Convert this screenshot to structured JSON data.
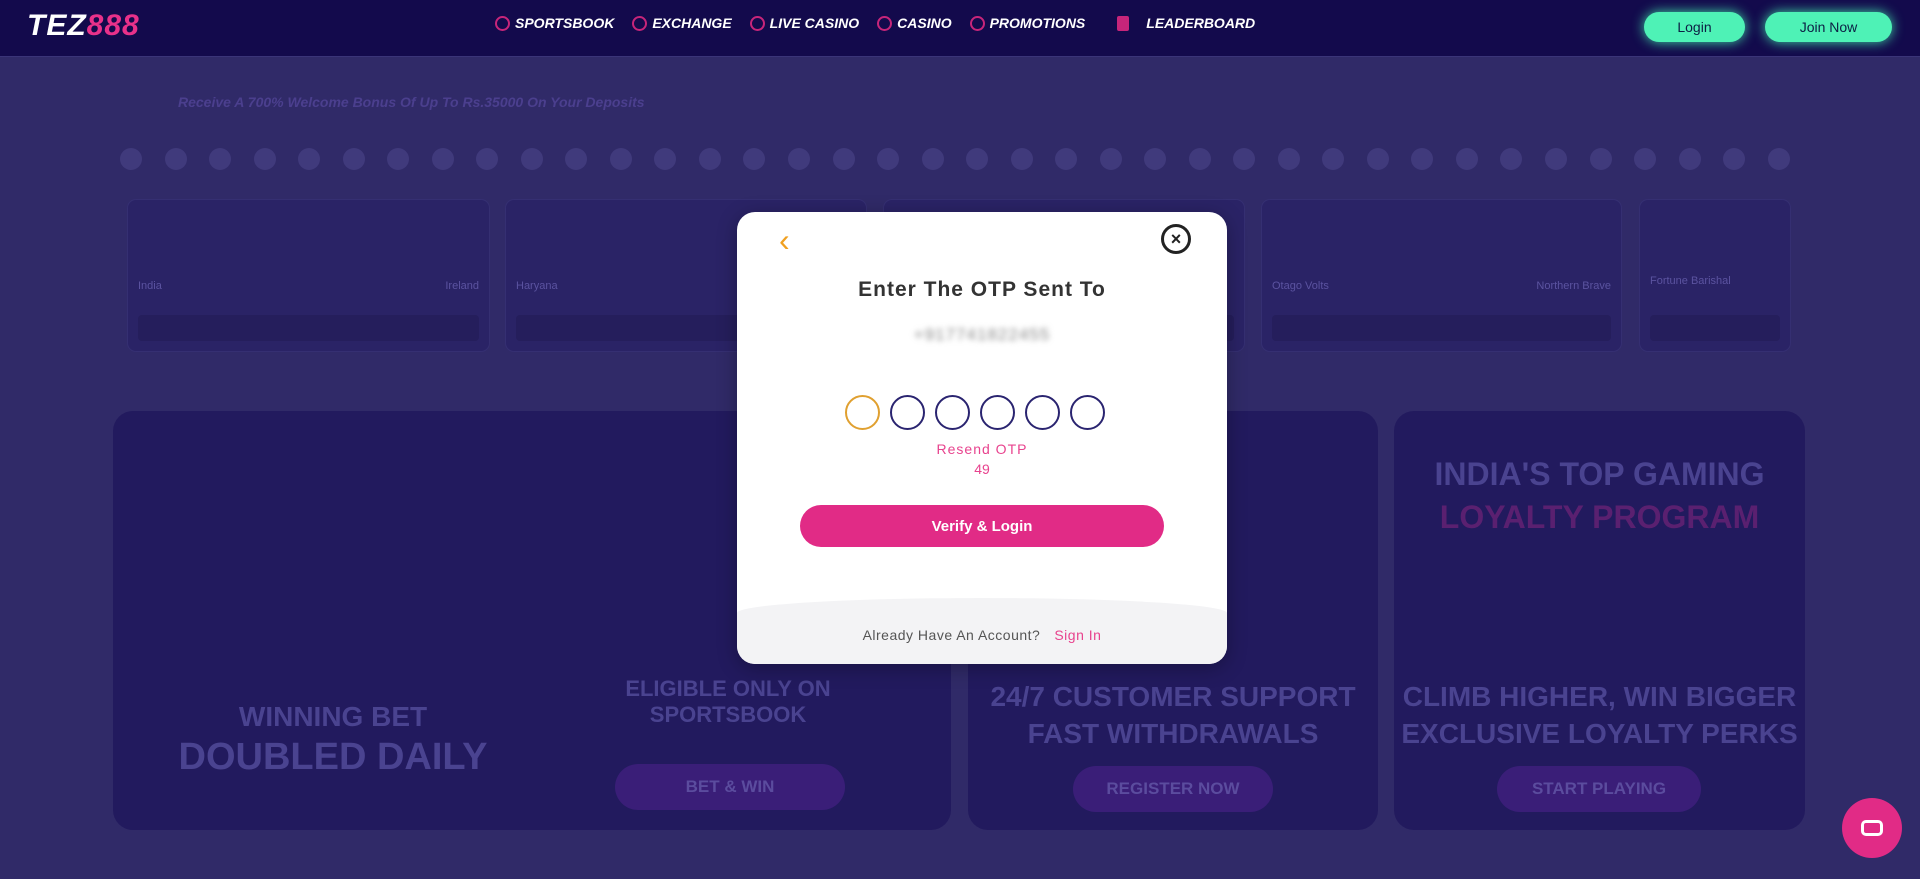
{
  "header": {
    "logo": "TEZ888",
    "logo_white": "TEZ",
    "logo_pink": "888",
    "nav": [
      {
        "label": "SPORTSBOOK",
        "icon": "sportsbook-icon"
      },
      {
        "label": "EXCHANGE",
        "icon": "exchange-icon"
      },
      {
        "label": "LIVE CASINO",
        "icon": "live-casino-icon"
      },
      {
        "label": "CASINO",
        "icon": "casino-icon"
      },
      {
        "label": "PROMOTIONS",
        "icon": "promotions-icon"
      },
      {
        "label": "LEADERBOARD",
        "icon": "leaderboard-icon"
      }
    ],
    "login": "Login",
    "join": "Join Now"
  },
  "marquee": "Receive A 700% Welcome Bonus Of Up To Rs.35000 On Your Deposits",
  "matches": [
    {
      "team1": "India",
      "team2": "Ireland"
    },
    {
      "team1": "Haryana",
      "team2": ""
    },
    {
      "team1": "",
      "team2": ""
    },
    {
      "team1": "Otago Volts",
      "team2": "Northern Brave"
    },
    {
      "team1": "Fortune Barishal",
      "team2": ""
    }
  ],
  "banners": [
    {
      "lines": [
        "WINNING BET",
        "DOUBLED DAILY",
        "ELIGIBLE ONLY ON SPORTSBOOK"
      ],
      "button": "BET & WIN"
    },
    {
      "lines": [
        "24/7 CUSTOMER SUPPORT",
        "FAST WITHDRAWALS"
      ],
      "button": "REGISTER NOW"
    },
    {
      "lines": [
        "INDIA'S TOP GAMING",
        "LOYALTY PROGRAM",
        "CLIMB HIGHER, WIN BIGGER",
        "EXCLUSIVE LOYALTY PERKS"
      ],
      "button": "START PLAYING"
    }
  ],
  "modal": {
    "title": "Enter The OTP Sent To",
    "phone": "+917741822455",
    "otp_digits": [
      "",
      "",
      "",
      "",
      "",
      ""
    ],
    "resend": "Resend OTP",
    "timer": "49",
    "verify": "Verify & Login",
    "footer_text": "Already Have An Account?",
    "sign_in": "Sign In"
  },
  "colors": {
    "accent": "#e12b86",
    "cta": "#4ef2b6",
    "header": "#130a4c",
    "otp_active": "#e0a030"
  }
}
